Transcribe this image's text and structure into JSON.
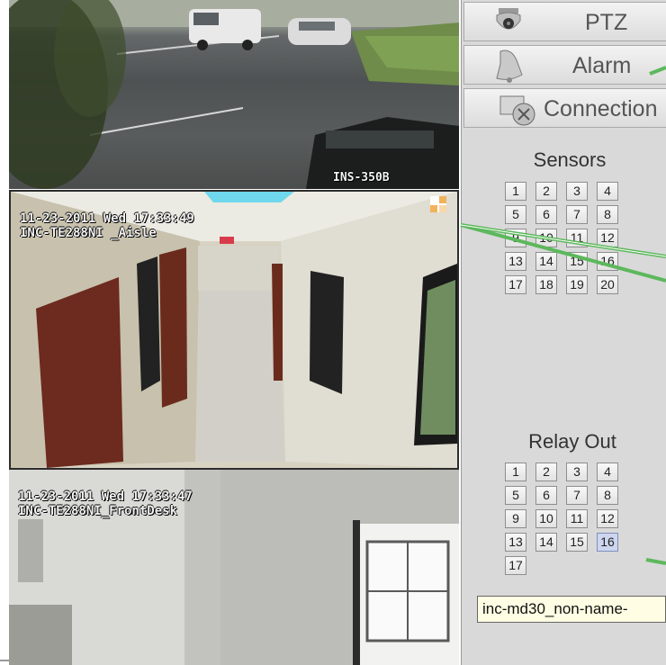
{
  "cameras": [
    {
      "label": "INS-350B",
      "date_line": "",
      "name_line": ""
    },
    {
      "label": "",
      "date_line": "11-23-2011 Wed 17:33:49",
      "name_line": "INC-TE288NI _Aisle"
    },
    {
      "label": "",
      "date_line": "11-23-2011 Wed 17:33:47",
      "name_line": "INC-TE288NI_FrontDesk"
    }
  ],
  "panel": {
    "nav": [
      {
        "label": "PTZ",
        "icon": "dome-camera-icon"
      },
      {
        "label": "Alarm",
        "icon": "bell-icon"
      },
      {
        "label": "Connection",
        "icon": "connection-icon"
      }
    ],
    "sensors": {
      "title": "Sensors",
      "items": [
        "1",
        "2",
        "3",
        "4",
        "5",
        "6",
        "7",
        "8",
        "9",
        "10",
        "11",
        "12",
        "13",
        "14",
        "15",
        "16",
        "17",
        "18",
        "19",
        "20"
      ]
    },
    "relay_out": {
      "title": "Relay Out",
      "items": [
        "1",
        "2",
        "3",
        "4",
        "5",
        "6",
        "7",
        "8",
        "9",
        "10",
        "11",
        "12",
        "13",
        "14",
        "15",
        "16",
        "17"
      ],
      "selected": "16"
    },
    "tooltip": "inc-md30_non-name-"
  },
  "colors": {
    "callout_line": "#5cb85c",
    "panel_bg": "#d9d9d9",
    "selected_cell": "#cdd6ee"
  }
}
